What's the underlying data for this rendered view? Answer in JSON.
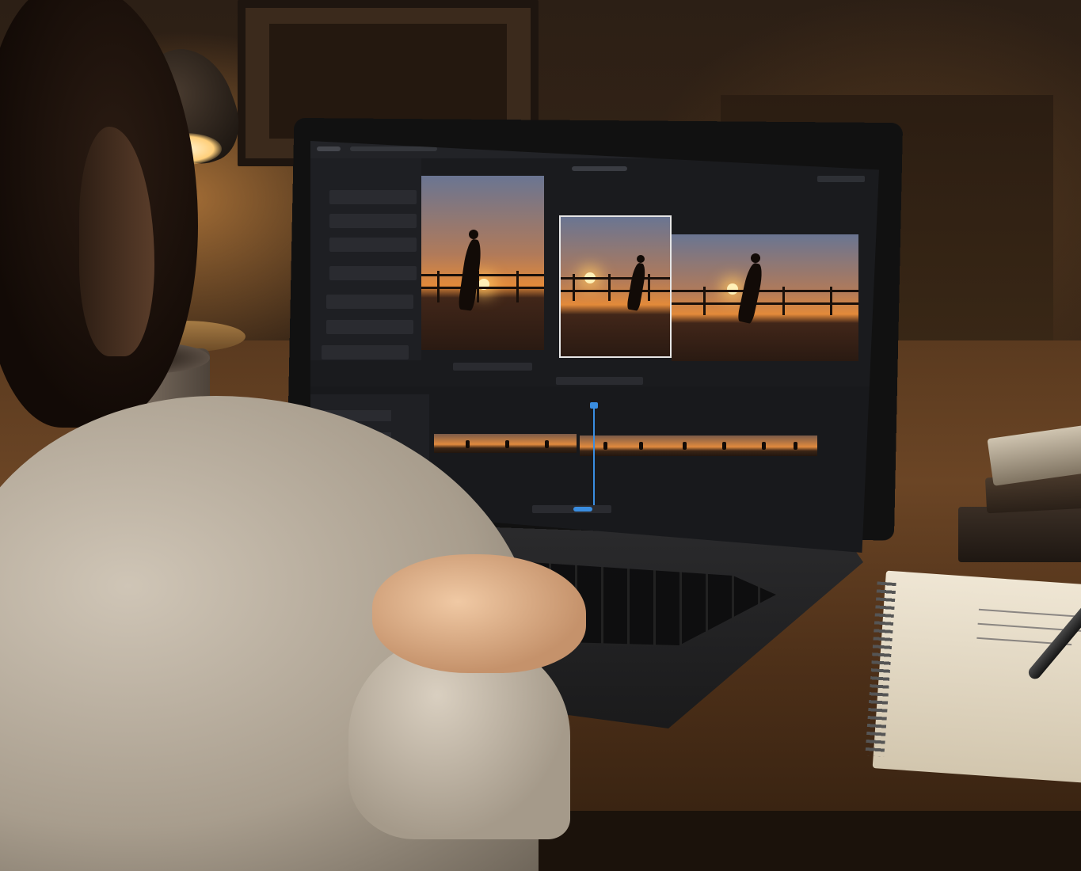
{
  "scene": {
    "description_tags": [
      "person",
      "laptop",
      "video-editor",
      "desk-lamp",
      "mug",
      "books",
      "notebook",
      "pen"
    ]
  },
  "app": {
    "theme": "dark",
    "accent_color": "#3a8de0",
    "preview_photos": [
      {
        "name": "runner-sunset-portrait"
      },
      {
        "name": "runner-sunset-selected"
      },
      {
        "name": "runner-sunset-landscape"
      }
    ],
    "timeline": {
      "clips": [
        {
          "name": "clip-1",
          "runners": 3
        },
        {
          "name": "clip-2",
          "runners": 6
        }
      ]
    }
  },
  "notebook": {
    "title": ""
  },
  "colors": {
    "sunset": "#e38a3a",
    "sky": "#6a7592",
    "screen_bg": "#1a1b1e",
    "playhead": "#3a8de0"
  }
}
